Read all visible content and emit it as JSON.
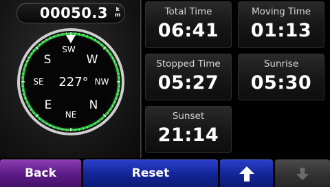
{
  "odometer": {
    "value": "00050.3",
    "unit_top": "k",
    "unit_bottom": "m"
  },
  "compass": {
    "heading": "227°",
    "labels": {
      "w": "W",
      "nw": "NW",
      "n": "N",
      "ne": "NE",
      "e": "E",
      "se": "SE",
      "s": "S",
      "sw": "SW"
    }
  },
  "stats": [
    {
      "label": "Total Time",
      "value": "06:41"
    },
    {
      "label": "Moving Time",
      "value": "01:13"
    },
    {
      "label": "Stopped Time",
      "value": "05:27"
    },
    {
      "label": "Sunrise",
      "value": "05:30"
    },
    {
      "label": "Sunset",
      "value": "21:14"
    }
  ],
  "buttons": {
    "back": "Back",
    "reset": "Reset",
    "up_icon": "arrow-up-icon",
    "down_icon": "arrow-down-icon"
  },
  "colors": {
    "compass_ring": "#2ecc40",
    "back_button": "#6a2090",
    "blue_button": "#1a2fa8",
    "disabled_button": "#3a3a3a"
  }
}
